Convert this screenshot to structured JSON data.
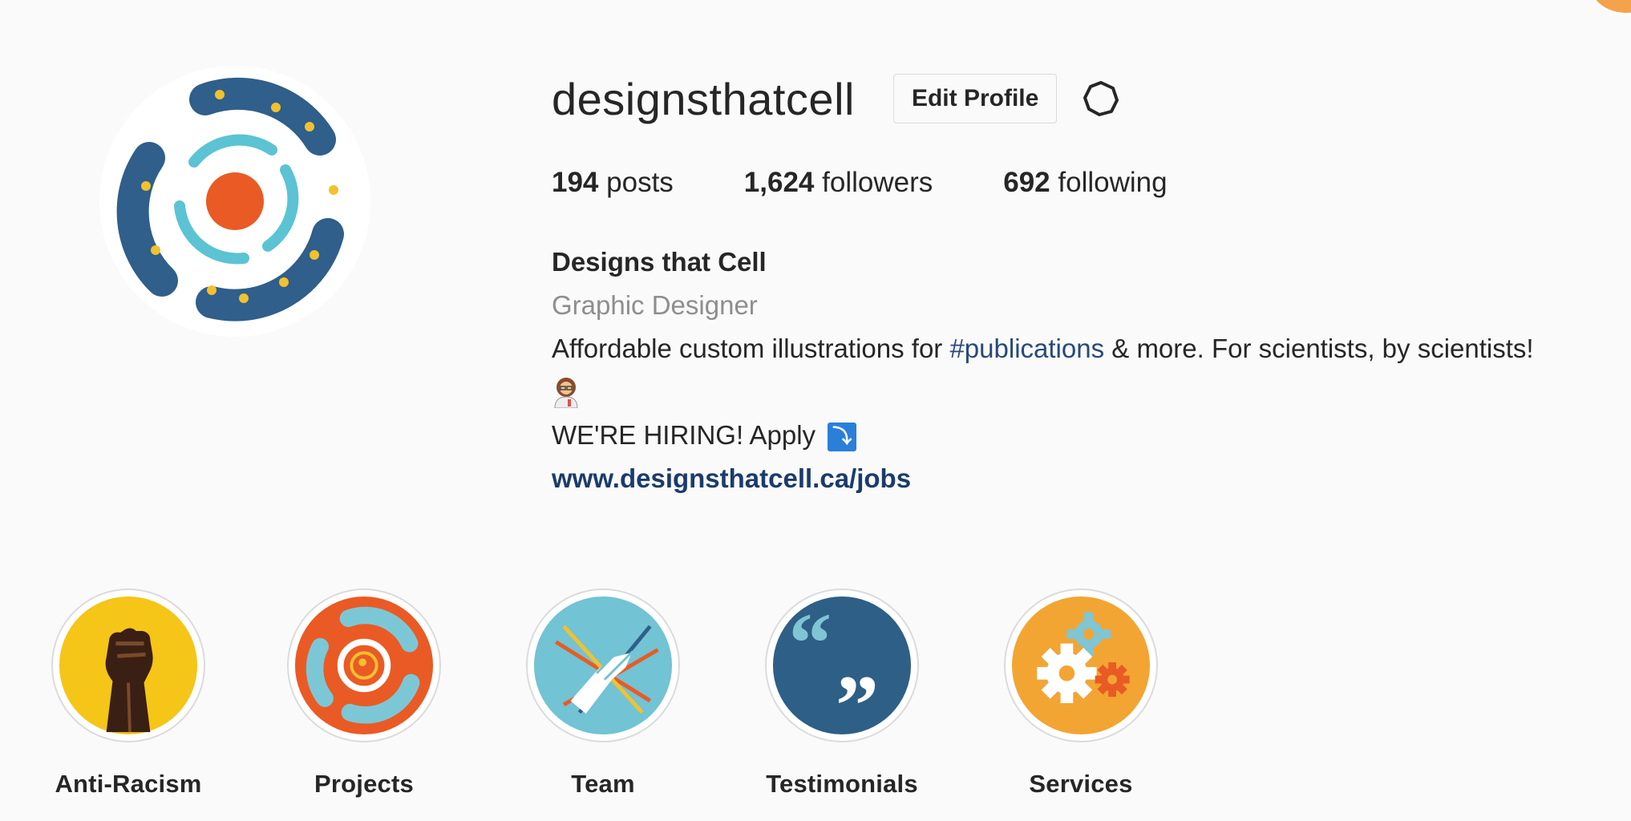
{
  "profile": {
    "username": "designsthatcell",
    "edit_label": "Edit Profile",
    "posts_count": "194",
    "posts_label": "posts",
    "followers_count": "1,624",
    "followers_label": "followers",
    "following_count": "692",
    "following_label": "following"
  },
  "bio": {
    "name": "Designs that Cell",
    "category": "Graphic Designer",
    "text_before": "Affordable custom illustrations for ",
    "hashtag": "#publications",
    "text_after": " & more. For scientists, by scientists!",
    "emoji": "👩‍🔬",
    "hiring": "WE'RE HIRING! Apply",
    "hiring_icon": "⤵",
    "link": "www.designsthatcell.ca/jobs"
  },
  "highlights": [
    {
      "label": "Anti-Racism",
      "icon": "raised-fist-icon"
    },
    {
      "label": "Projects",
      "icon": "cell-logo-icon"
    },
    {
      "label": "Team",
      "icon": "handshake-icon"
    },
    {
      "label": "Testimonials",
      "icon": "quote-icon"
    },
    {
      "label": "Services",
      "icon": "gears-icon"
    }
  ],
  "colors": {
    "logo_dark_blue": "#2f5f8a",
    "logo_light_blue": "#5bc3d4",
    "logo_orange": "#ea5a25",
    "logo_yellow": "#f2c12e",
    "link_blue": "#1b3b6b"
  }
}
